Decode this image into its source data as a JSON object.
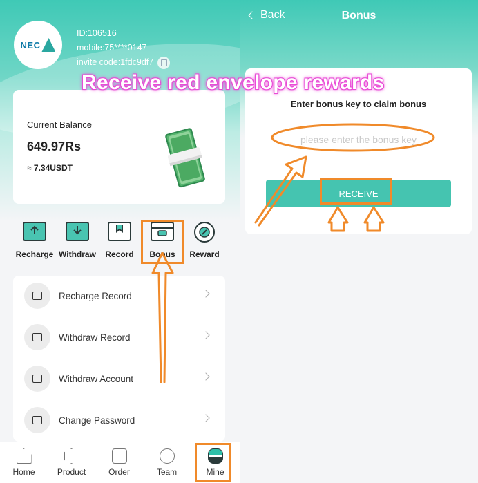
{
  "left": {
    "user": {
      "logo_text": "NEC",
      "id_label": "ID: ",
      "id_value": "106516",
      "mobile_label": "mobile: ",
      "mobile_value": "75****0147",
      "invite_label": "invite code: ",
      "invite_value": "1fdc9df7"
    },
    "balance": {
      "label": "Current Balance",
      "amount": "649.97Rs",
      "usdt": "≈ 7.34USDT"
    },
    "quick_actions": [
      {
        "label": "Recharge",
        "icon": "recharge-icon"
      },
      {
        "label": "Withdraw",
        "icon": "withdraw-icon"
      },
      {
        "label": "Record",
        "icon": "record-icon"
      },
      {
        "label": "Bonus",
        "icon": "bonus-icon"
      },
      {
        "label": "Reward",
        "icon": "reward-icon"
      }
    ],
    "menu": [
      {
        "label": "Recharge Record",
        "icon": "recharge-record-icon"
      },
      {
        "label": "Withdraw Record",
        "icon": "withdraw-record-icon"
      },
      {
        "label": "Withdraw Account",
        "icon": "withdraw-account-icon"
      },
      {
        "label": "Change Password",
        "icon": "lock-icon"
      }
    ],
    "tabs": [
      {
        "label": "Home",
        "icon": "home-icon"
      },
      {
        "label": "Product",
        "icon": "product-icon"
      },
      {
        "label": "Order",
        "icon": "order-icon"
      },
      {
        "label": "Team",
        "icon": "team-icon"
      },
      {
        "label": "Mine",
        "icon": "mine-icon"
      }
    ]
  },
  "right": {
    "back_label": "Back",
    "title": "Bonus",
    "heading": "Enter bonus key to claim bonus",
    "input_placeholder": "please enter the bonus key",
    "input_value": "",
    "receive_label": "RECEIVE"
  },
  "annotation": {
    "banner": "Receive red envelope rewards",
    "color": "#f08a2a",
    "banner_glow": "#e94bd6"
  },
  "colors": {
    "accent": "#45c4b0",
    "header_gradient_top": "#3fc9b6"
  }
}
